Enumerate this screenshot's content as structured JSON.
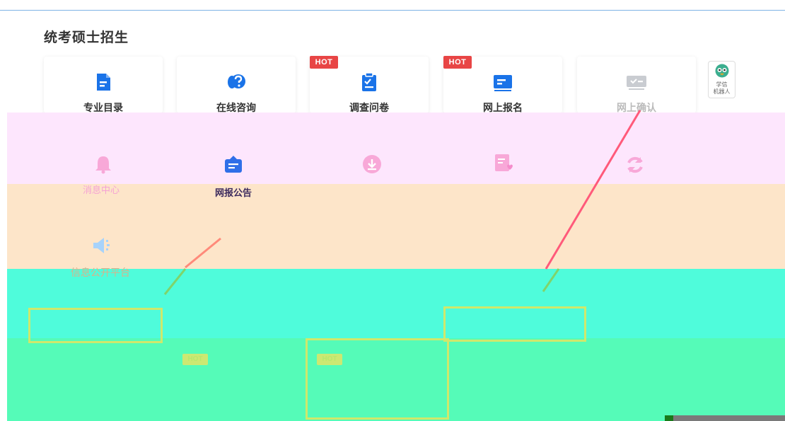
{
  "section": {
    "title": "统考硕士招生"
  },
  "cards": [
    {
      "label": "专业目录",
      "icon": "catalog-doc-icon",
      "hot": false
    },
    {
      "label": "在线咨询",
      "icon": "chat-question-icon",
      "hot": false
    },
    {
      "label": "调查问卷",
      "icon": "clipboard-check-icon",
      "hot": true
    },
    {
      "label": "网上报名",
      "icon": "online-form-icon",
      "hot": true
    },
    {
      "label": "网上确认",
      "icon": "confirm-icon",
      "hot": false
    }
  ],
  "badge_text": "HOT",
  "robot": {
    "line1": "学信",
    "line2": "机器人",
    "icon": "robot-avatar-icon"
  },
  "row2": [
    {
      "label": "消息中心",
      "icon": "bell-icon"
    },
    {
      "label": "网报公告",
      "icon": "notice-box-icon"
    },
    {
      "label": "",
      "icon": "download-icon"
    },
    {
      "label": "",
      "icon": "favorite-doc-icon"
    },
    {
      "label": "",
      "icon": "refresh-icon"
    }
  ],
  "row3": [
    {
      "label": "信息公开平台",
      "icon": "speaker-icon"
    }
  ],
  "colors": {
    "accent_blue": "#1a73e8",
    "hot_red": "#e84545",
    "rule_blue": "#7fb3e6",
    "band_pink": "#fde6fd",
    "band_peach": "#fde5c9",
    "band_cyan": "#4ffcdb",
    "band_mint": "#55fbb8"
  }
}
